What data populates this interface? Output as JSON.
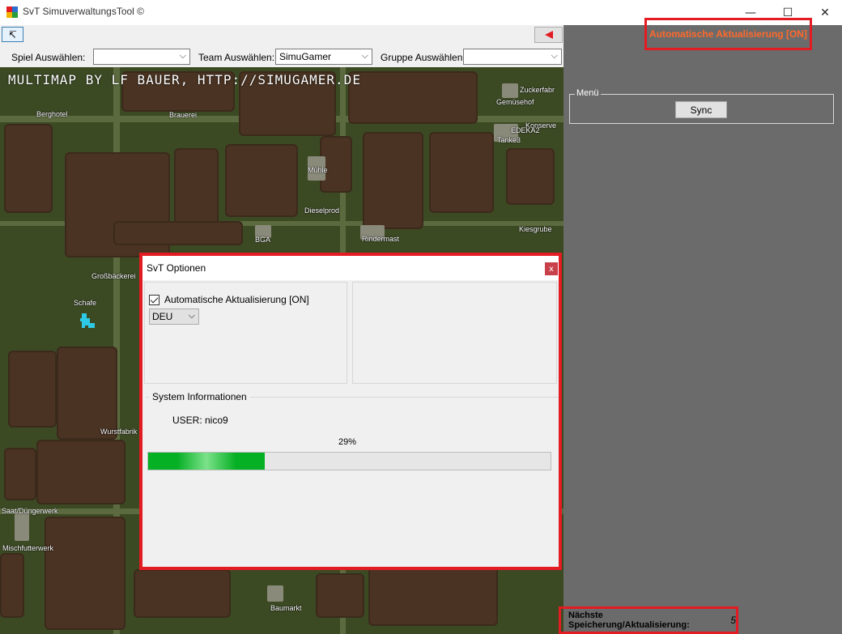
{
  "window": {
    "title": "SvT SimuverwaltungsTool ©",
    "minimize_glyph": "—",
    "maximize_glyph": "☐",
    "close_glyph": "✕"
  },
  "toolbar": {
    "back_icon": "↸",
    "spiel_label": "Spiel Auswählen:",
    "spiel_value": "",
    "team_label": "Team Auswählen:",
    "team_value": "SimuGamer",
    "gruppe_label": "Gruppe Auswählen:",
    "gruppe_value": "",
    "dropdown_glyph": "⌵"
  },
  "map": {
    "banner": "MULTIMAP BY LF BAUER, HTTP://SIMUGAMER.DE",
    "places": [
      {
        "name": "Berghotel"
      },
      {
        "name": "Brauerei"
      },
      {
        "name": "Zuckerfabr"
      },
      {
        "name": "Gemüsehof"
      },
      {
        "name": "Konserve"
      },
      {
        "name": "EDEKA2"
      },
      {
        "name": "Tanke3"
      },
      {
        "name": "Mühle"
      },
      {
        "name": "Dieselprod"
      },
      {
        "name": "Kiesgrube"
      },
      {
        "name": "BGA"
      },
      {
        "name": "Rindermast"
      },
      {
        "name": "Großbäckerei"
      },
      {
        "name": "Schafe"
      },
      {
        "name": "Wurstfabrik"
      },
      {
        "name": "Saat/Düngerwerk"
      },
      {
        "name": "Mischfutterwerk"
      },
      {
        "name": "Baumarkt"
      }
    ],
    "marker_color": "#2ec9e6"
  },
  "right_panel": {
    "auto_update": "Automatische Aktualisierung [ON]",
    "menu_legend": "Menü",
    "sync_label": "Sync",
    "next_save_label": "Nächste Speicherung/Aktualisierung:",
    "next_save_value": "5"
  },
  "dialog": {
    "title": "SvT Optionen",
    "close_glyph": "x",
    "checkbox_label": "Automatische Aktualisierung [ON]",
    "checkbox_checked": true,
    "language_value": "DEU",
    "system_legend": "System Informationen",
    "user_text": "USER: nico9",
    "progress_text": "29%",
    "progress_value": 0.29
  },
  "colors": {
    "highlight_red": "#e31b23",
    "auto_update_text": "#ff6a2b",
    "progress_green": "#06b025",
    "panel_gray": "#6b6b6b"
  }
}
